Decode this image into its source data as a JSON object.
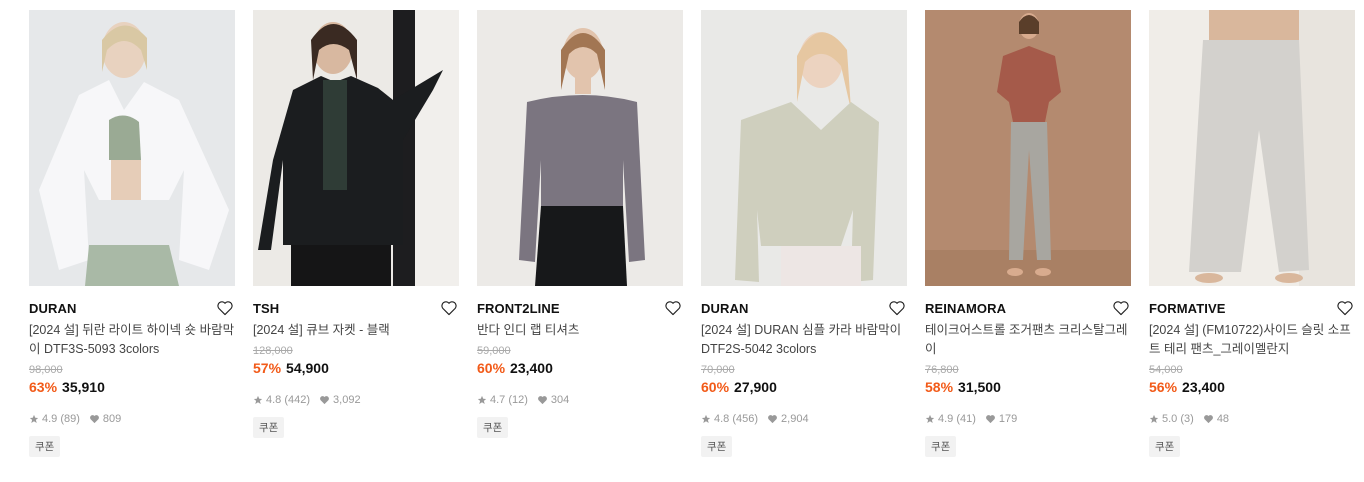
{
  "products": [
    {
      "brand": "DURAN",
      "title": "[2024 설] 뒤란 라이트 하이넥 숏 바람막이 DTF3S-5093 3colors",
      "original_price": "98,000",
      "discount": "63%",
      "price": "35,910",
      "rating": "4.9",
      "reviews": "(89)",
      "likes": "809",
      "coupon": "쿠폰",
      "image": "model-white-windbreaker"
    },
    {
      "brand": "TSH",
      "title": "[2024 설] 큐브 자켓 - 블랙",
      "original_price": "128,000",
      "discount": "57%",
      "price": "54,900",
      "rating": "4.8",
      "reviews": "(442)",
      "likes": "3,092",
      "coupon": "쿠폰",
      "image": "model-black-quilted-jacket"
    },
    {
      "brand": "FRONT2LINE",
      "title": "반다 인디 랩 티셔츠",
      "original_price": "59,000",
      "discount": "60%",
      "price": "23,400",
      "rating": "4.7",
      "reviews": "(12)",
      "likes": "304",
      "coupon": "쿠폰",
      "image": "model-gray-wrap-tshirt"
    },
    {
      "brand": "DURAN",
      "title": "[2024 설] DURAN 심플 카라 바람막이 DTF2S-5042 3colors",
      "original_price": "70,000",
      "discount": "60%",
      "price": "27,900",
      "rating": "4.8",
      "reviews": "(456)",
      "likes": "2,904",
      "coupon": "쿠폰",
      "image": "model-beige-collar-windbreaker"
    },
    {
      "brand": "REINAMORA",
      "title": "테이크어스트롤 조거팬츠 크리스탈그레이",
      "original_price": "76,800",
      "discount": "58%",
      "price": "31,500",
      "rating": "4.9",
      "reviews": "(41)",
      "likes": "179",
      "coupon": "쿠폰",
      "image": "model-gray-jogger-pants"
    },
    {
      "brand": "FORMATIVE",
      "title": "[2024 설] (FM10722)사이드 슬릿 소프트 테리 팬츠_그레이멜란지",
      "original_price": "54,000",
      "discount": "56%",
      "price": "23,400",
      "rating": "5.0",
      "reviews": "(3)",
      "likes": "48",
      "coupon": "쿠폰",
      "image": "model-gray-terry-pants"
    }
  ],
  "colors": {
    "discount": "#f25a18",
    "strike": "#aaaaaa",
    "meta": "#999999"
  },
  "icons": {
    "like": "heart-outline-icon",
    "star": "star-icon",
    "likes": "heart-filled-icon"
  }
}
